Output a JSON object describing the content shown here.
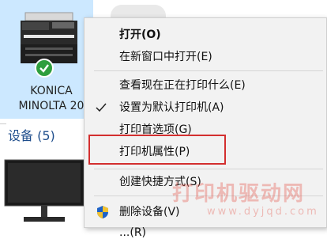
{
  "printer": {
    "name": "KONICA\nMINOLTA 20",
    "status_icon": "green-checkmark-icon",
    "tile_color": "#cce8ff"
  },
  "devices_section": {
    "header": "设备 (5)"
  },
  "context_menu": {
    "items": [
      {
        "label": "打开(O)",
        "bold": true
      },
      {
        "label": "在新窗口中打开(E)"
      },
      {
        "label": "查看现在正在打印什么(E)"
      },
      {
        "label": "设置为默认打印机(A)",
        "checked": true
      },
      {
        "label": "打印首选项(G)"
      },
      {
        "label": "打印机属性(P)",
        "highlighted": true
      },
      {
        "label": "创建快捷方式(S)"
      },
      {
        "label": "删除设备(V)",
        "icon": "uac-shield-icon"
      },
      {
        "label": "...(R)"
      }
    ],
    "highlight_color": "#d32f2f"
  },
  "watermark": {
    "text": "打印机驱动网",
    "url": "www.dyjqd.com"
  }
}
